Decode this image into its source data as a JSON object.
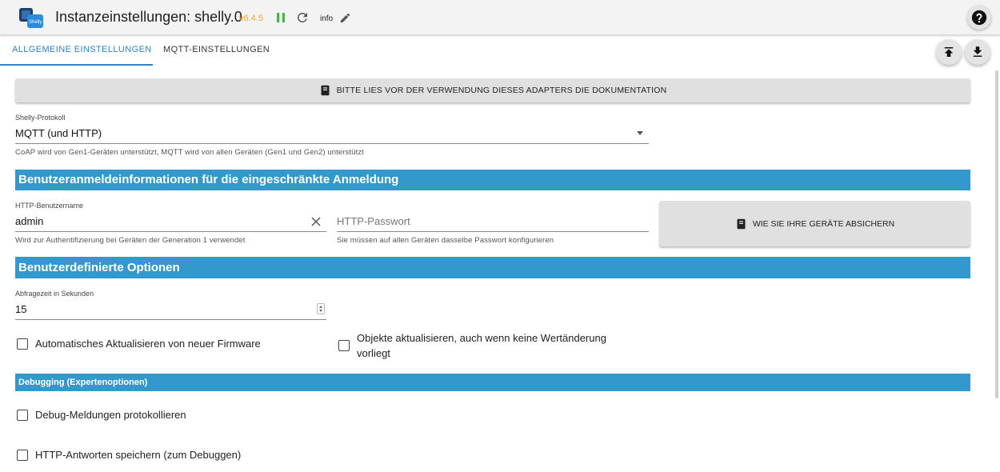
{
  "header": {
    "title": "Instanzeinstellungen: shelly.0",
    "version": "v6.4.5",
    "log_level": "info",
    "icons": [
      "shelly-logo-icon",
      "pause-icon",
      "reload-icon",
      "edit-icon",
      "help-icon"
    ]
  },
  "tabs": [
    {
      "label": "ALLGEMEINE EINSTELLUNGEN",
      "active": true
    },
    {
      "label": "MQTT-EINSTELLUNGEN",
      "active": false
    }
  ],
  "doc_button": {
    "label": "BITTE LIES VOR DER VERWENDUNG DIESES ADAPTERS DIE DOKUMENTATION"
  },
  "protocol": {
    "label": "Shelly-Protokoll",
    "value": "MQTT (und HTTP)",
    "helper": "CoAP wird von Gen1-Geräten unterstützt, MQTT wird von allen Geräten (Gen1 und Gen2) unterstützt"
  },
  "sections": {
    "credentials": "Benutzeranmeldeinformationen für die eingeschränkte Anmeldung",
    "custom": "Benutzerdefinierte Optionen",
    "debugging": "Debugging (Expertenoptionen)"
  },
  "username": {
    "label": "HTTP-Benutzername",
    "value": "admin",
    "helper": "Wird zur Authentifizierung bei Geräten der Generation 1 verwendet"
  },
  "password": {
    "placeholder": "HTTP-Passwort",
    "helper": "Sie müssen auf allen Geräten dasselbe Passwort konfigurieren"
  },
  "secure_button": {
    "label": "WIE SIE IHRE GERÄTE ABSICHERN"
  },
  "poll": {
    "label": "Abfragezeit in Sekunden",
    "value": "15"
  },
  "checkboxes": {
    "auto_update": {
      "label": "Automatisches Aktualisieren von neuer Firmware",
      "checked": false
    },
    "update_objects": {
      "label": "Objekte aktualisieren, auch wenn keine Wertänderung vorliegt",
      "checked": false
    },
    "debug_log": {
      "label": "Debug-Meldungen protokollieren",
      "checked": false
    },
    "http_save": {
      "label": "HTTP-Antworten speichern (zum Debuggen)",
      "checked": false
    }
  },
  "colors": {
    "accent": "#2f82c4",
    "section": "#3399cc",
    "version": "#f0a830",
    "pause": "#4caf50"
  }
}
